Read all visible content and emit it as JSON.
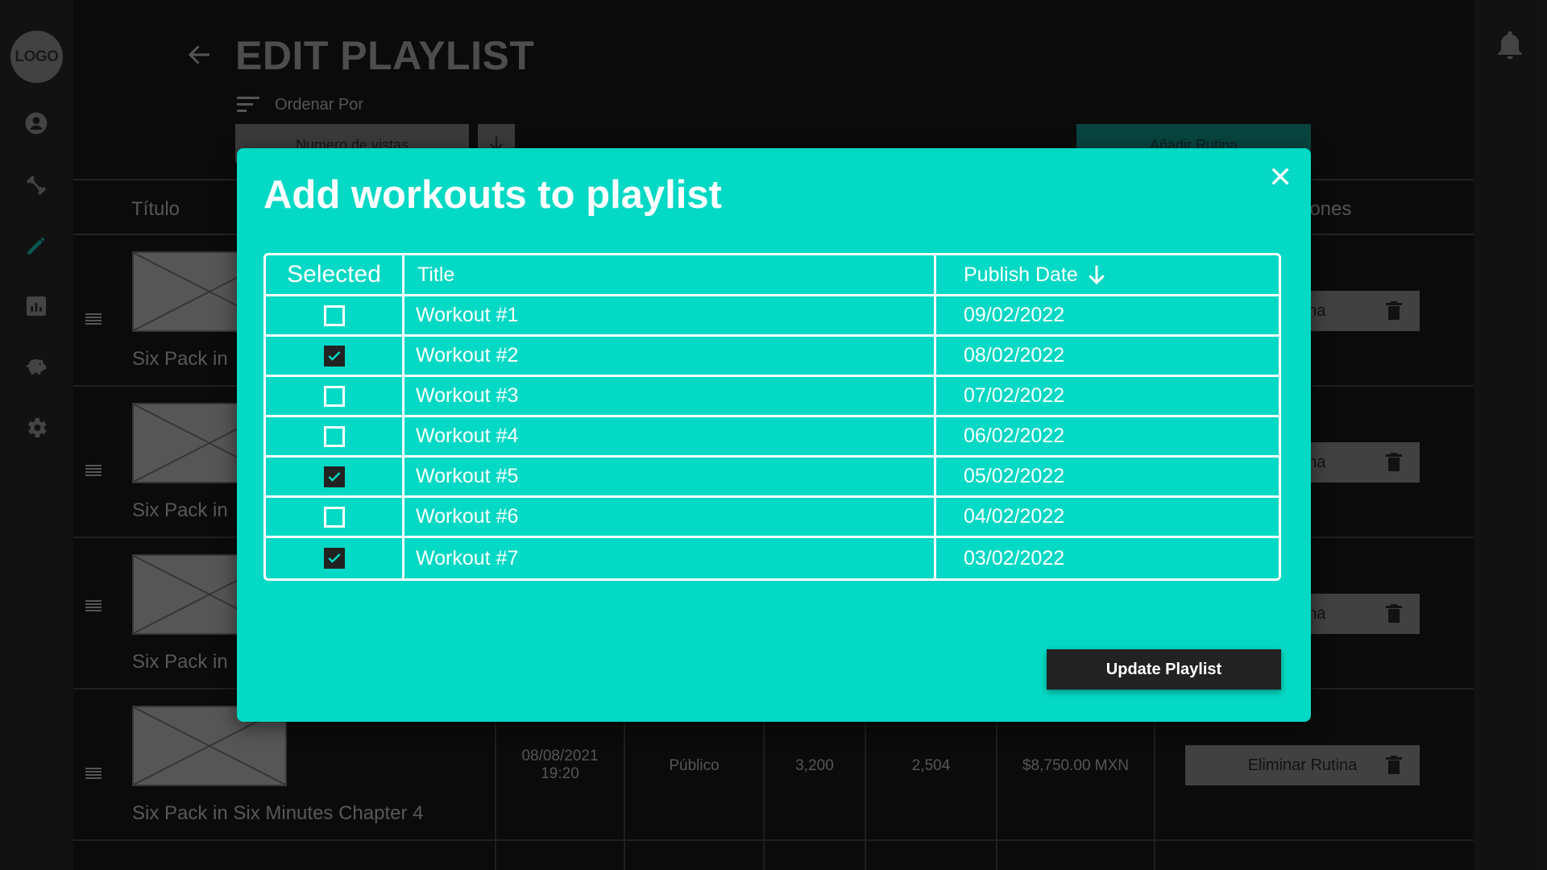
{
  "sidebar": {
    "logo_text": "LOGO",
    "icons": [
      "user-icon",
      "dumbbell-icon",
      "edit-icon",
      "analytics-icon",
      "piggy-bank-icon",
      "settings-icon"
    ],
    "active_color": "#0e8f82"
  },
  "header": {
    "title": "EDIT PLAYLIST",
    "sort_label": "Ordenar Por",
    "sort_value": "Numero de vistas",
    "add_button": "Añadir Rutina"
  },
  "table": {
    "col_title": "Título",
    "col_actions_partial": "iones",
    "rows": [
      {
        "title": "Six Pack in",
        "action": "Rutina"
      },
      {
        "title": "Six Pack in",
        "action": "Rutina"
      },
      {
        "title": "Six Pack in",
        "action": "Rutina"
      },
      {
        "title": "Six Pack in Six Minutes Chapter 4",
        "date": "08/08/2021",
        "time": "19:20",
        "visibility": "Público",
        "views": "3,200",
        "likes": "2,504",
        "revenue": "$8,750.00 MXN",
        "action": "Eliminar Rutina"
      }
    ]
  },
  "modal": {
    "title": "Add workouts to playlist",
    "columns": {
      "selected": "Selected",
      "title": "Title",
      "publish_date": "Publish Date"
    },
    "workouts": [
      {
        "title": "Workout #1",
        "date": "09/02/2022",
        "selected": false
      },
      {
        "title": "Workout #2",
        "date": "08/02/2022",
        "selected": true
      },
      {
        "title": "Workout #3",
        "date": "07/02/2022",
        "selected": false
      },
      {
        "title": "Workout #4",
        "date": "06/02/2022",
        "selected": false
      },
      {
        "title": "Workout #5",
        "date": "05/02/2022",
        "selected": true
      },
      {
        "title": "Workout #6",
        "date": "04/02/2022",
        "selected": false
      },
      {
        "title": "Workout #7",
        "date": "03/02/2022",
        "selected": true
      }
    ],
    "update_button": "Update Playlist",
    "colors": {
      "modal_bg": "#03d9c4",
      "button_bg": "#222222"
    }
  }
}
